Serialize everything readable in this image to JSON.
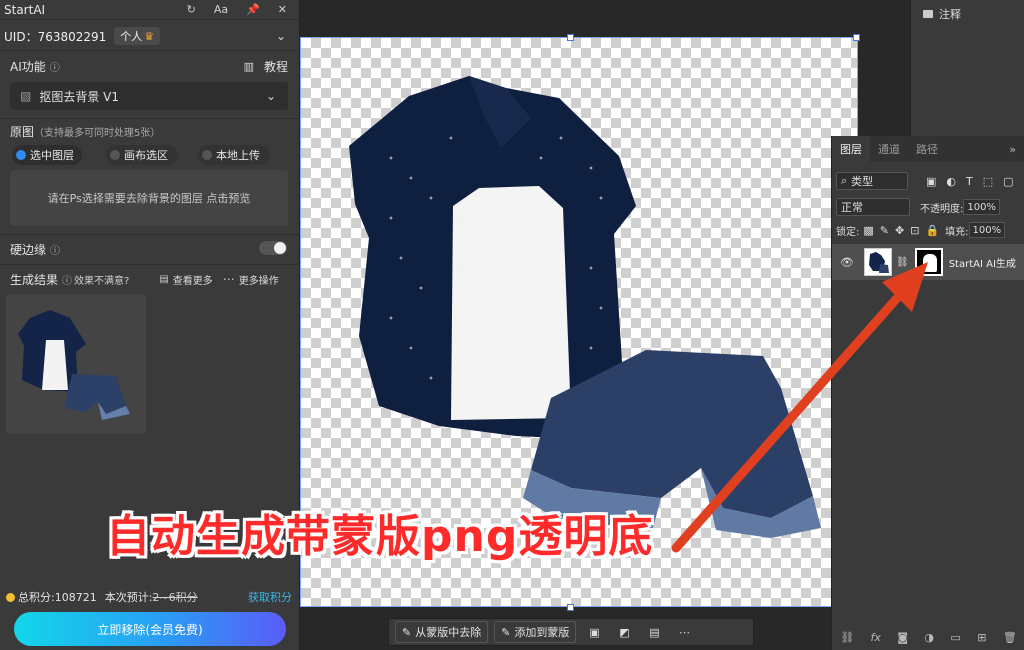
{
  "plugin": {
    "title": "StartAI",
    "uid_label": "UID：763802291",
    "user_badge": "个人",
    "ai_function_label": "AI功能",
    "tutorial_label": "教程",
    "feature_select": "抠图去背景 V1",
    "original_label": "原图",
    "original_note": "（支持最多可同时处理5张）",
    "source_options": [
      "选中图层",
      "画布选区",
      "本地上传"
    ],
    "hint_text": "请在Ps选择需要去除背景的图层 点击预览",
    "hard_edge_label": "硬边缘",
    "results_label": "生成结果",
    "unsatisfied_label": "效果不满意?",
    "view_more_label": "查看更多",
    "more_ops_label": "更多操作",
    "total_points": "总积分:108721",
    "estimate_label": "本次预计:",
    "estimate_value": "2~6积分",
    "get_points_label": "获取积分",
    "remove_button": "立即移除(会员免费)"
  },
  "right_dock": {
    "note_label": "注释"
  },
  "layers_panel": {
    "tabs": [
      "图层",
      "通道",
      "路径"
    ],
    "filter_label": "类型",
    "blend_mode": "正常",
    "opacity_label": "不透明度:",
    "opacity_value": "100%",
    "lock_label": "锁定:",
    "fill_label": "填充:",
    "fill_value": "100%",
    "layer_name": "StartAI AI生成"
  },
  "bottom_toolbar": {
    "remove_from_mask": "从蒙版中去除",
    "add_to_mask": "添加到蒙版"
  },
  "overlay_caption": "自动生成带蒙版png透明底",
  "colors": {
    "accent_blue": "#2e8cf0",
    "caption_red": "#ff2b2b",
    "arrow_red": "#e04020"
  }
}
